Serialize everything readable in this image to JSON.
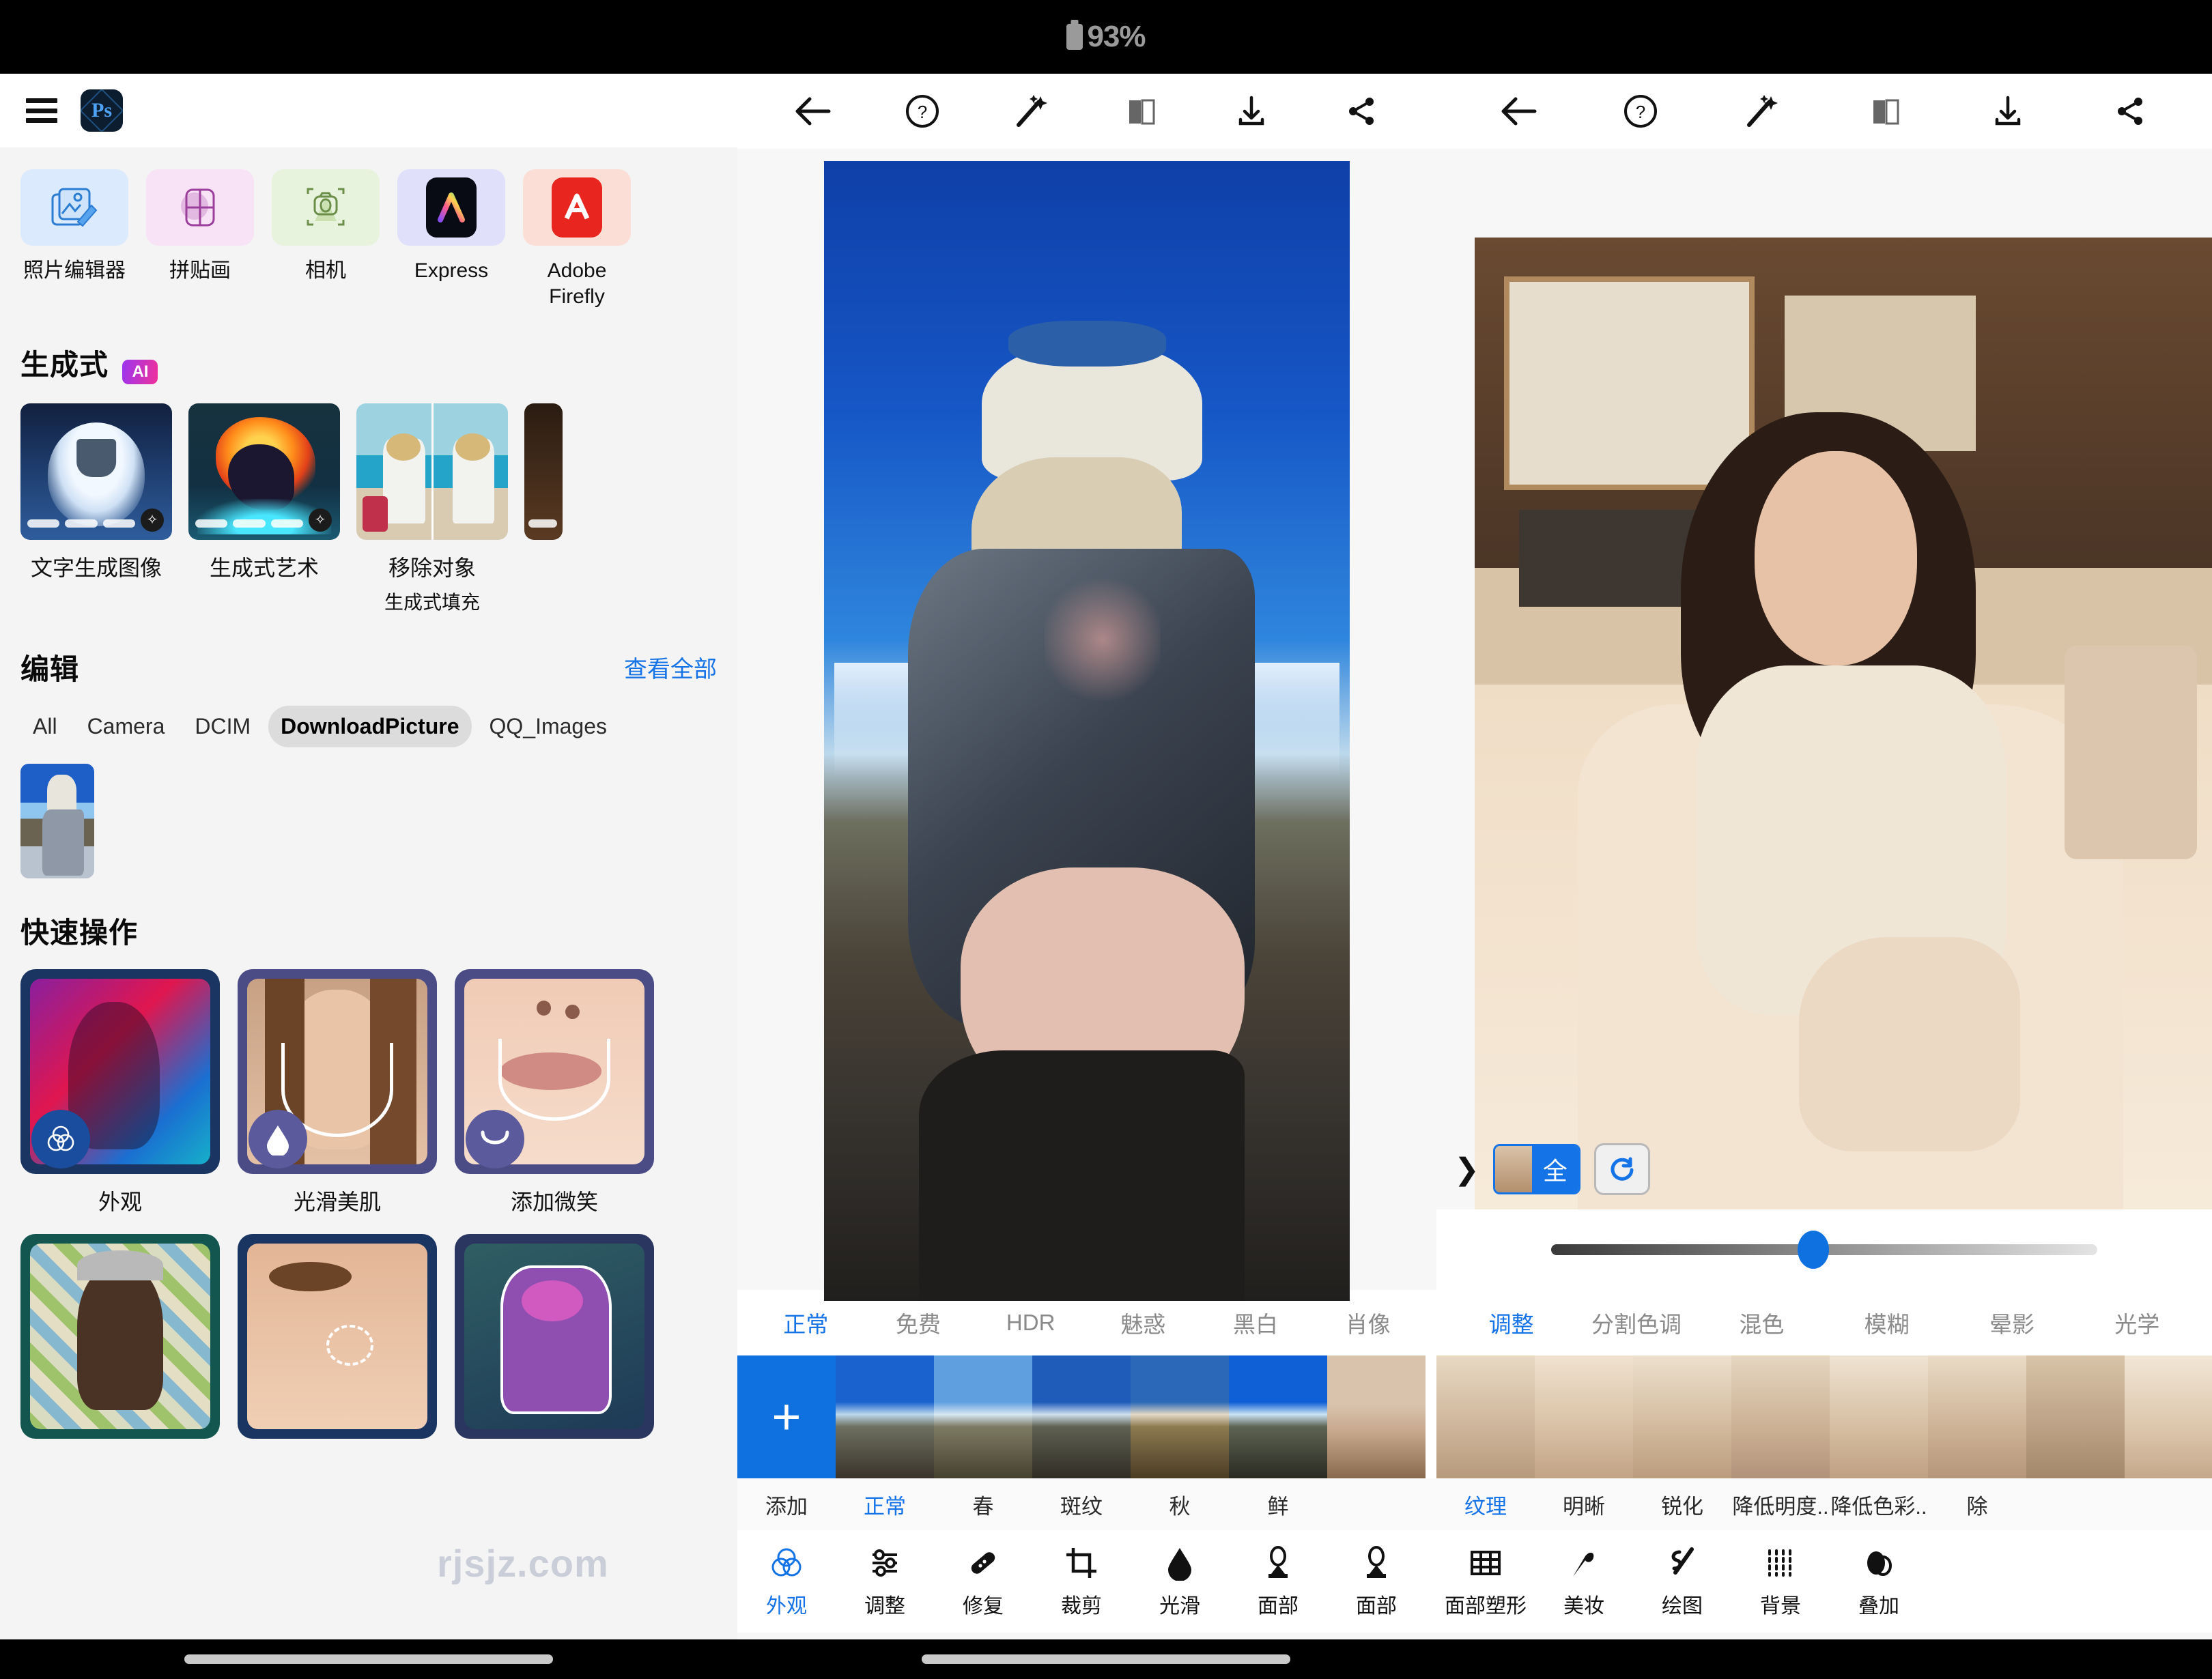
{
  "status_bar": {
    "battery_percent": "93%",
    "battery_icon": "battery-icon"
  },
  "left_panel": {
    "app": {
      "name": "Photoshop Express",
      "logo_text": "Ps",
      "menu_icon": "hamburger-menu-icon"
    },
    "tools": [
      {
        "label": "照片编辑器",
        "icon": "photo-editor-icon"
      },
      {
        "label": "拼贴画",
        "icon": "collage-icon"
      },
      {
        "label": "相机",
        "icon": "camera-icon"
      },
      {
        "label": "Express",
        "icon": "adobe-express-icon"
      },
      {
        "label": "Adobe Firefly",
        "icon": "adobe-firefly-icon"
      }
    ],
    "generative": {
      "title": "生成式",
      "badge": "AI",
      "cards": [
        {
          "label": "文字生成图像",
          "sub": "",
          "thumb": "cloud-dress-thumb"
        },
        {
          "label": "生成式艺术",
          "sub": "",
          "thumb": "fire-unicorn-thumb"
        },
        {
          "label": "移除对象",
          "sub": "生成式填充",
          "thumb": "remove-object-thumb"
        },
        {
          "label": "",
          "sub": "",
          "thumb": "partial-thumb"
        }
      ]
    },
    "edit": {
      "title": "编辑",
      "view_all": "查看全部",
      "folders": [
        "All",
        "Camera",
        "DCIM",
        "DownloadPicture",
        "QQ_Images"
      ],
      "active_folder": "DownloadPicture",
      "gallery_count": 1
    },
    "quick_actions": {
      "title": "快速操作",
      "items": [
        {
          "label": "外观",
          "icon": "looks-icon"
        },
        {
          "label": "光滑美肌",
          "icon": "smooth-skin-icon"
        },
        {
          "label": "添加微笑",
          "icon": "add-smile-icon"
        },
        {
          "label": "",
          "icon": "background-icon"
        },
        {
          "label": "",
          "icon": "blemish-icon"
        },
        {
          "label": "",
          "icon": "overlay-icon"
        }
      ]
    },
    "watermark": "rjsjz.com"
  },
  "editor_middle": {
    "toolbar": [
      {
        "name": "back-icon",
        "label": "返回"
      },
      {
        "name": "help-icon",
        "label": "帮助"
      },
      {
        "name": "magic-wand-icon",
        "label": "自动"
      },
      {
        "name": "compare-icon",
        "label": "对比"
      },
      {
        "name": "download-icon",
        "label": "下载"
      },
      {
        "name": "share-icon",
        "label": "分享"
      }
    ],
    "tabs": [
      "正常",
      "免费",
      "HDR",
      "魅惑",
      "黑白",
      "肖像"
    ],
    "active_tab": "正常",
    "filmstrip": [
      {
        "label": "添加",
        "type": "add"
      },
      {
        "label": "正常",
        "type": "preset",
        "active": true
      },
      {
        "label": "春",
        "type": "preset"
      },
      {
        "label": "斑纹",
        "type": "preset"
      },
      {
        "label": "秋",
        "type": "preset"
      },
      {
        "label": "鲜",
        "type": "preset"
      }
    ]
  },
  "editor_right": {
    "toolbar": [
      {
        "name": "back-icon",
        "label": "返回"
      },
      {
        "name": "help-icon",
        "label": "帮助"
      },
      {
        "name": "magic-wand-icon",
        "label": "自动"
      },
      {
        "name": "compare-icon",
        "label": "对比"
      },
      {
        "name": "download-icon",
        "label": "下载"
      },
      {
        "name": "share-icon",
        "label": "分享"
      }
    ],
    "overlay": {
      "expand_icon": "chevron-right-icon",
      "scope_label": "全",
      "reset_icon": "reset-icon"
    },
    "slider": {
      "value_percent": 48
    },
    "tabs": [
      "调整",
      "分割色调",
      "混色",
      "模糊",
      "晕影",
      "光学"
    ],
    "active_tab": "调整",
    "filmstrip": [
      {
        "label": "纹理",
        "active": true
      },
      {
        "label": "明晰"
      },
      {
        "label": "锐化"
      },
      {
        "label": "降低明度.."
      },
      {
        "label": "降低色彩.."
      },
      {
        "label": "除"
      }
    ]
  },
  "bottom_nav": {
    "items": [
      {
        "label": "外观",
        "icon": "looks-icon",
        "active": true
      },
      {
        "label": "调整",
        "icon": "adjust-sliders-icon"
      },
      {
        "label": "修复",
        "icon": "heal-icon"
      },
      {
        "label": "裁剪",
        "icon": "crop-icon"
      },
      {
        "label": "光滑",
        "icon": "smooth-droplet-icon"
      },
      {
        "label": "面部",
        "icon": "face-icon"
      },
      {
        "label": "面部",
        "icon": "face-icon"
      },
      {
        "label": "面部塑形",
        "icon": "face-reshape-icon"
      },
      {
        "label": "美妆",
        "icon": "makeup-icon"
      },
      {
        "label": "绘图",
        "icon": "draw-icon"
      },
      {
        "label": "背景",
        "icon": "background-icon"
      },
      {
        "label": "叠加",
        "icon": "overlay-icon"
      }
    ]
  },
  "colors": {
    "accent_blue": "#1473e6",
    "filmstrip_add": "#0f71e0",
    "status_bg": "#000000",
    "panel_bg": "#f4f4f4"
  }
}
